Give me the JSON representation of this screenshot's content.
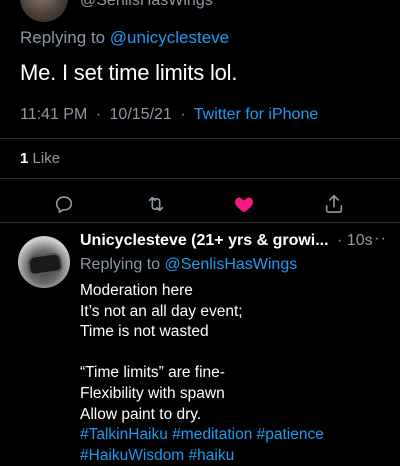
{
  "parent_tweet": {
    "handle": "@SenlisHasWings",
    "replying_prefix": "Replying to",
    "replying_to": "@unicyclesteve",
    "text": "Me. I set time limits lol.",
    "time": "11:41 PM",
    "date": "10/15/21",
    "separator": "·",
    "source": "Twitter for iPhone",
    "likes_count": "1",
    "likes_label": "Like",
    "liked": true
  },
  "actions": {
    "reply_icon": "reply-icon",
    "retweet_icon": "retweet-icon",
    "like_icon": "heart-icon",
    "share_icon": "share-icon",
    "like_color": "#f91880"
  },
  "reply_tweet": {
    "display_name": "Unicyclesteve (21+ yrs & growi...",
    "time": "· 10s",
    "more": "···",
    "replying_prefix": "Replying to",
    "replying_to": "@SenlisHasWings",
    "lines": [
      "Moderation here",
      "It’s not an all day event;",
      "Time is not wasted",
      "",
      "“Time limits”  are fine-",
      "Flexibility with spawn",
      "Allow paint to dry."
    ],
    "hashtags_line1": "#TalkinHaiku #meditation #patience",
    "hashtags_line2": "#HaikuWisdom #haiku"
  },
  "colors": {
    "background": "#000000",
    "link": "#1d9bf0",
    "muted": "#8b98a5",
    "divider": "#2f3336"
  }
}
